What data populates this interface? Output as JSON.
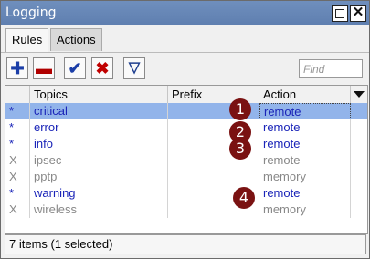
{
  "window": {
    "title": "Logging"
  },
  "tabs": [
    {
      "label": "Rules"
    },
    {
      "label": "Actions"
    }
  ],
  "toolbar": {
    "add_icon": "plus-icon",
    "remove_icon": "minus-icon",
    "enable_icon": "checkmark-icon",
    "disable_icon": "x-icon",
    "filter_icon": "filter-icon",
    "find_placeholder": "Find"
  },
  "table": {
    "columns": [
      "",
      "Topics",
      "Prefix",
      "Action"
    ],
    "rows": [
      {
        "flag": "*",
        "topics": "critical",
        "prefix": "",
        "action": "remote",
        "selected": true
      },
      {
        "flag": "*",
        "topics": "error",
        "prefix": "",
        "action": "remote"
      },
      {
        "flag": "*",
        "topics": "info",
        "prefix": "",
        "action": "remote"
      },
      {
        "flag": "X",
        "topics": "ipsec",
        "prefix": "",
        "action": "remote"
      },
      {
        "flag": "X",
        "topics": "pptp",
        "prefix": "",
        "action": "memory"
      },
      {
        "flag": "*",
        "topics": "warning",
        "prefix": "",
        "action": "remote"
      },
      {
        "flag": "X",
        "topics": "wireless",
        "prefix": "",
        "action": "memory"
      }
    ]
  },
  "badges": [
    "1",
    "2",
    "3",
    "4"
  ],
  "status": "7 items (1 selected)",
  "colors": {
    "title_bar": "#6f8fbd",
    "selected_row": "#92b4ea",
    "enabled_text": "#1a24b8",
    "disabled_text": "#888888",
    "badge": "#7a1212"
  }
}
